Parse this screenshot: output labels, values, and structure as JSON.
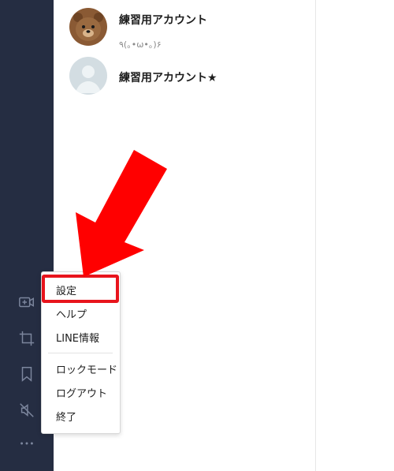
{
  "friends": [
    {
      "name": "練習用アカウント",
      "status": "٩(｡•ω•｡)۶",
      "avatar": "bear-avatar-icon"
    },
    {
      "name": "練習用アカウント★",
      "status": "",
      "avatar": "default-avatar-icon"
    }
  ],
  "sidebar": {
    "icons": [
      "video-call-add-icon",
      "crop-icon",
      "bookmark-icon",
      "mute-icon",
      "more-icon"
    ]
  },
  "menu": {
    "settings": "設定",
    "help": "ヘルプ",
    "line_info": "LINE情報",
    "lock_mode": "ロックモード",
    "logout": "ログアウト",
    "quit": "終了"
  },
  "colors": {
    "sidebar": "#252d42",
    "highlight": "#e8141c",
    "arrow": "#ff0000"
  }
}
